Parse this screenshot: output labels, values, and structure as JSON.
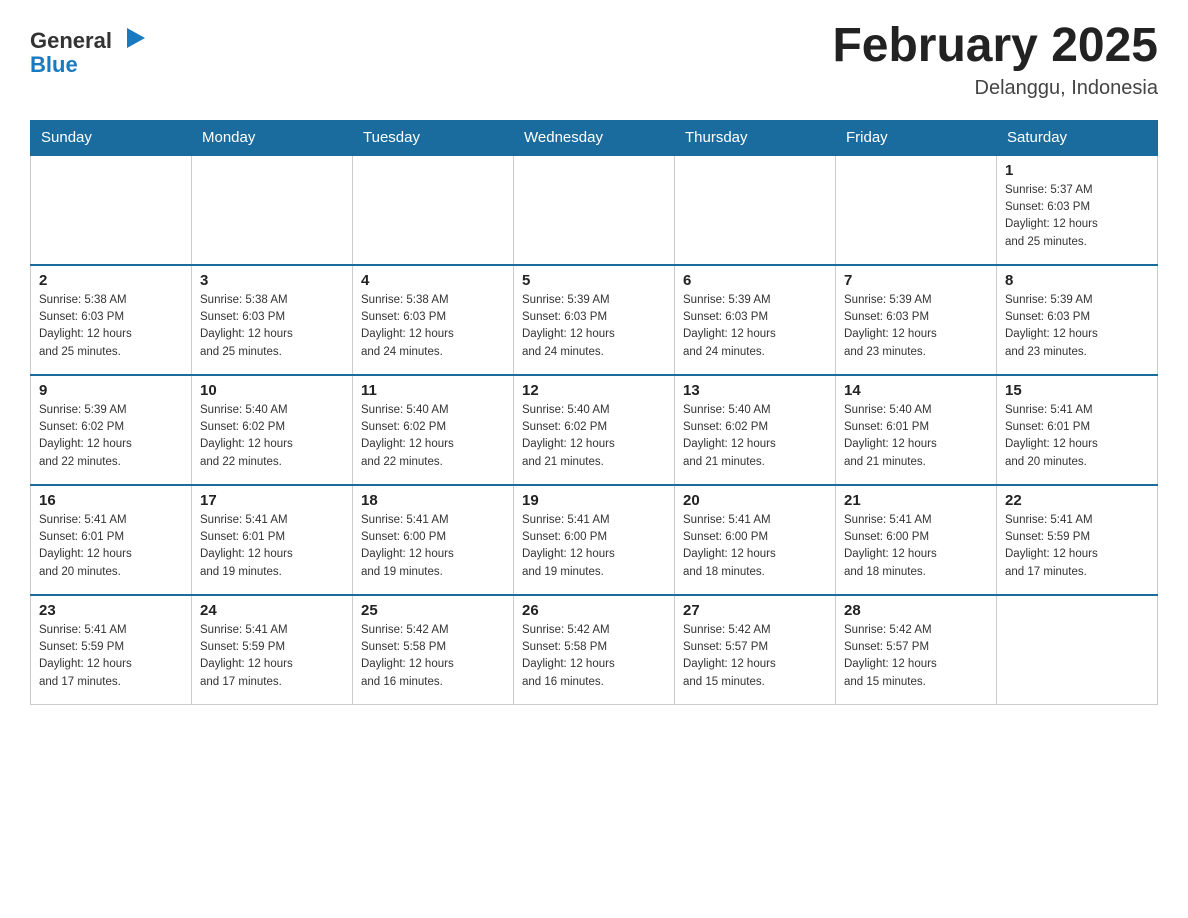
{
  "header": {
    "logo_general": "General",
    "logo_blue": "Blue",
    "month_title": "February 2025",
    "location": "Delanggu, Indonesia"
  },
  "days_of_week": [
    "Sunday",
    "Monday",
    "Tuesday",
    "Wednesday",
    "Thursday",
    "Friday",
    "Saturday"
  ],
  "weeks": [
    {
      "days": [
        {
          "date": "",
          "info": ""
        },
        {
          "date": "",
          "info": ""
        },
        {
          "date": "",
          "info": ""
        },
        {
          "date": "",
          "info": ""
        },
        {
          "date": "",
          "info": ""
        },
        {
          "date": "",
          "info": ""
        },
        {
          "date": "1",
          "info": "Sunrise: 5:37 AM\nSunset: 6:03 PM\nDaylight: 12 hours\nand 25 minutes."
        }
      ]
    },
    {
      "days": [
        {
          "date": "2",
          "info": "Sunrise: 5:38 AM\nSunset: 6:03 PM\nDaylight: 12 hours\nand 25 minutes."
        },
        {
          "date": "3",
          "info": "Sunrise: 5:38 AM\nSunset: 6:03 PM\nDaylight: 12 hours\nand 25 minutes."
        },
        {
          "date": "4",
          "info": "Sunrise: 5:38 AM\nSunset: 6:03 PM\nDaylight: 12 hours\nand 24 minutes."
        },
        {
          "date": "5",
          "info": "Sunrise: 5:39 AM\nSunset: 6:03 PM\nDaylight: 12 hours\nand 24 minutes."
        },
        {
          "date": "6",
          "info": "Sunrise: 5:39 AM\nSunset: 6:03 PM\nDaylight: 12 hours\nand 24 minutes."
        },
        {
          "date": "7",
          "info": "Sunrise: 5:39 AM\nSunset: 6:03 PM\nDaylight: 12 hours\nand 23 minutes."
        },
        {
          "date": "8",
          "info": "Sunrise: 5:39 AM\nSunset: 6:03 PM\nDaylight: 12 hours\nand 23 minutes."
        }
      ]
    },
    {
      "days": [
        {
          "date": "9",
          "info": "Sunrise: 5:39 AM\nSunset: 6:02 PM\nDaylight: 12 hours\nand 22 minutes."
        },
        {
          "date": "10",
          "info": "Sunrise: 5:40 AM\nSunset: 6:02 PM\nDaylight: 12 hours\nand 22 minutes."
        },
        {
          "date": "11",
          "info": "Sunrise: 5:40 AM\nSunset: 6:02 PM\nDaylight: 12 hours\nand 22 minutes."
        },
        {
          "date": "12",
          "info": "Sunrise: 5:40 AM\nSunset: 6:02 PM\nDaylight: 12 hours\nand 21 minutes."
        },
        {
          "date": "13",
          "info": "Sunrise: 5:40 AM\nSunset: 6:02 PM\nDaylight: 12 hours\nand 21 minutes."
        },
        {
          "date": "14",
          "info": "Sunrise: 5:40 AM\nSunset: 6:01 PM\nDaylight: 12 hours\nand 21 minutes."
        },
        {
          "date": "15",
          "info": "Sunrise: 5:41 AM\nSunset: 6:01 PM\nDaylight: 12 hours\nand 20 minutes."
        }
      ]
    },
    {
      "days": [
        {
          "date": "16",
          "info": "Sunrise: 5:41 AM\nSunset: 6:01 PM\nDaylight: 12 hours\nand 20 minutes."
        },
        {
          "date": "17",
          "info": "Sunrise: 5:41 AM\nSunset: 6:01 PM\nDaylight: 12 hours\nand 19 minutes."
        },
        {
          "date": "18",
          "info": "Sunrise: 5:41 AM\nSunset: 6:00 PM\nDaylight: 12 hours\nand 19 minutes."
        },
        {
          "date": "19",
          "info": "Sunrise: 5:41 AM\nSunset: 6:00 PM\nDaylight: 12 hours\nand 19 minutes."
        },
        {
          "date": "20",
          "info": "Sunrise: 5:41 AM\nSunset: 6:00 PM\nDaylight: 12 hours\nand 18 minutes."
        },
        {
          "date": "21",
          "info": "Sunrise: 5:41 AM\nSunset: 6:00 PM\nDaylight: 12 hours\nand 18 minutes."
        },
        {
          "date": "22",
          "info": "Sunrise: 5:41 AM\nSunset: 5:59 PM\nDaylight: 12 hours\nand 17 minutes."
        }
      ]
    },
    {
      "days": [
        {
          "date": "23",
          "info": "Sunrise: 5:41 AM\nSunset: 5:59 PM\nDaylight: 12 hours\nand 17 minutes."
        },
        {
          "date": "24",
          "info": "Sunrise: 5:41 AM\nSunset: 5:59 PM\nDaylight: 12 hours\nand 17 minutes."
        },
        {
          "date": "25",
          "info": "Sunrise: 5:42 AM\nSunset: 5:58 PM\nDaylight: 12 hours\nand 16 minutes."
        },
        {
          "date": "26",
          "info": "Sunrise: 5:42 AM\nSunset: 5:58 PM\nDaylight: 12 hours\nand 16 minutes."
        },
        {
          "date": "27",
          "info": "Sunrise: 5:42 AM\nSunset: 5:57 PM\nDaylight: 12 hours\nand 15 minutes."
        },
        {
          "date": "28",
          "info": "Sunrise: 5:42 AM\nSunset: 5:57 PM\nDaylight: 12 hours\nand 15 minutes."
        },
        {
          "date": "",
          "info": ""
        }
      ]
    }
  ]
}
